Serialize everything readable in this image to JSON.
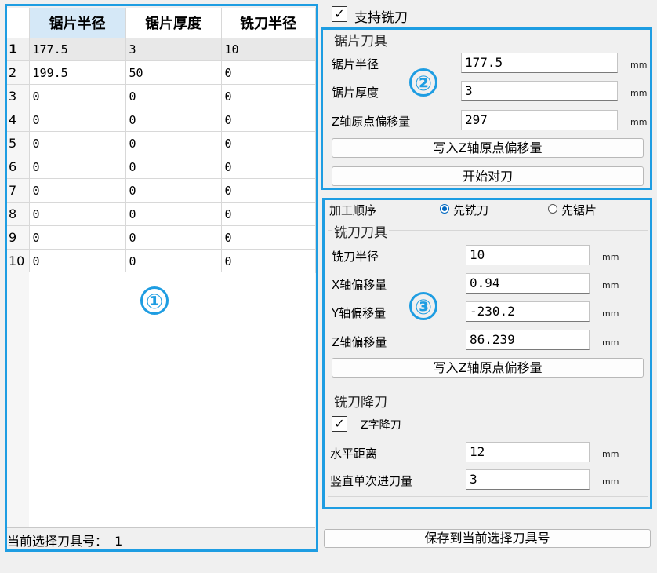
{
  "table": {
    "columns": [
      "锯片半径",
      "锯片厚度",
      "铣刀半径"
    ],
    "rows": [
      {
        "no": "1",
        "cells": [
          "177.5",
          "3",
          "10"
        ]
      },
      {
        "no": "2",
        "cells": [
          "199.5",
          "50",
          "0"
        ]
      },
      {
        "no": "3",
        "cells": [
          "0",
          "0",
          "0"
        ]
      },
      {
        "no": "4",
        "cells": [
          "0",
          "0",
          "0"
        ]
      },
      {
        "no": "5",
        "cells": [
          "0",
          "0",
          "0"
        ]
      },
      {
        "no": "6",
        "cells": [
          "0",
          "0",
          "0"
        ]
      },
      {
        "no": "7",
        "cells": [
          "0",
          "0",
          "0"
        ]
      },
      {
        "no": "8",
        "cells": [
          "0",
          "0",
          "0"
        ]
      },
      {
        "no": "9",
        "cells": [
          "0",
          "0",
          "0"
        ]
      },
      {
        "no": "10",
        "cells": [
          "0",
          "0",
          "0"
        ]
      }
    ],
    "status_label": "当前选择刀具号：",
    "status_value": "1"
  },
  "annotations": {
    "one": "①",
    "two": "②",
    "three": "③"
  },
  "support_mill": {
    "label": "支持铣刀",
    "checked": true
  },
  "saw": {
    "title": "锯片刀具",
    "radius_label": "锯片半径",
    "radius_value": "177.5",
    "thickness_label": "锯片厚度",
    "thickness_value": "3",
    "z_offset_label": "Z轴原点偏移量",
    "z_offset_value": "297",
    "unit": "mm",
    "write_z_button": "写入Z轴原点偏移量",
    "start_button": "开始对刀"
  },
  "process": {
    "order_label": "加工顺序",
    "option_mill": "先铣刀",
    "option_saw": "先锯片",
    "selected": "先铣刀"
  },
  "mill": {
    "title": "铣刀刀具",
    "radius_label": "铣刀半径",
    "radius_value": "10",
    "x_label": "X轴偏移量",
    "x_value": "0.94",
    "y_label": "Y轴偏移量",
    "y_value": "-230.2",
    "z_label": "Z轴偏移量",
    "z_value": "86.239",
    "unit": "mm",
    "write_z_button": "写入Z轴原点偏移量"
  },
  "descend": {
    "title": "铣刀降刀",
    "z_descend_label": "Z字降刀",
    "z_descend_checked": true,
    "horizontal_label": "水平距离",
    "horizontal_value": "12",
    "vertical_label": "竖直单次进刀量",
    "vertical_value": "3",
    "unit": "mm"
  },
  "save_button": "保存到当前选择刀具号",
  "colors": {
    "annotation_blue": "#1e9de2",
    "selected_header": "#d5e8f7"
  }
}
